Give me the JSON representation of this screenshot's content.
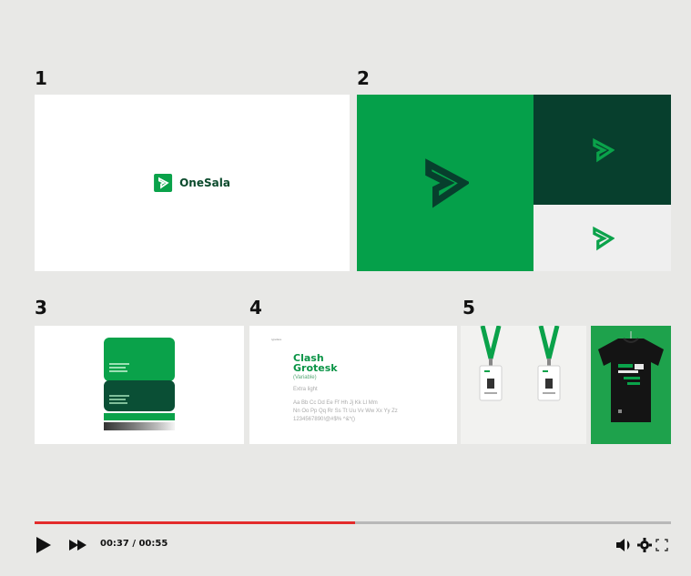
{
  "panels": [
    {
      "number": "1"
    },
    {
      "number": "2"
    },
    {
      "number": "3"
    },
    {
      "number": "4"
    },
    {
      "number": "5"
    }
  ],
  "brand": {
    "name": "OneSala",
    "accent": "#0aa24a",
    "dark": "#073f2d"
  },
  "typography": {
    "header": "typeface",
    "font_name": "Clash Grotesk",
    "font_variant": "(Variable)",
    "weight": "Extra light",
    "alphabet_line1": "Aa Bb Cc Dd Ee Ff Hh Jj Kk Ll Mm",
    "alphabet_line2": "Nn Oo Pp Qq Rr Ss Tt Uu Vv Ww Xx Yy Zz",
    "digits_line": "1234567890!@#$% ^&*()"
  },
  "player": {
    "current_time": "00:37",
    "duration": "00:55",
    "time_display": "00:37 / 00:55",
    "progress": 0.503,
    "progress_color": "#e32b2b"
  }
}
